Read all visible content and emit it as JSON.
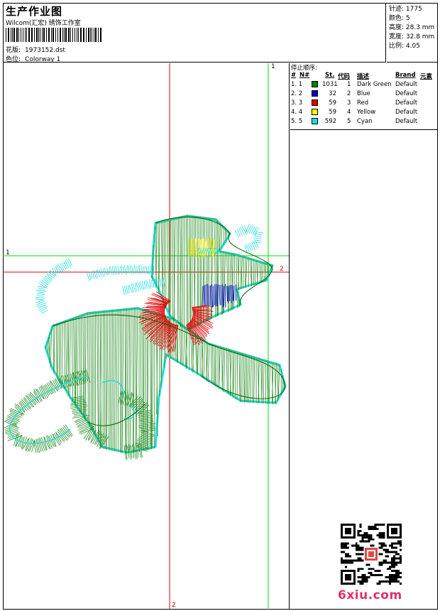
{
  "header": {
    "title": "生产作业图",
    "subtitle": "Wilcom(汇宏) 绣饰工作室",
    "file_label": "花版:",
    "file_name": "1973152.dst",
    "colorway_label": "色位:",
    "colorway_name": "Colorway 1"
  },
  "stats": {
    "stitches": "针迹: 1775",
    "colors": "颜色: 5",
    "height": "高度: 28.3 mm",
    "width": "宽度: 32.8 mm",
    "scale": "比例: 4.05"
  },
  "axis_labels": {
    "top_right": "1",
    "left": "1",
    "right": "2",
    "bottom": "2"
  },
  "color_table": {
    "caption": "停止顺序:",
    "headers": [
      "#",
      "N#",
      "St.",
      "代码",
      "描述",
      "Brand",
      "元素"
    ],
    "rows": [
      {
        "idx": "1. 1",
        "color": "#008000",
        "st": "1031",
        "code": "1",
        "desc": "Dark Green",
        "brand": "Default"
      },
      {
        "idx": "2. 2",
        "color": "#0000cc",
        "st": "32",
        "code": "2",
        "desc": "Blue",
        "brand": "Default"
      },
      {
        "idx": "3. 3",
        "color": "#e00000",
        "st": "59",
        "code": "3",
        "desc": "Red",
        "brand": "Default"
      },
      {
        "idx": "4. 4",
        "color": "#ffff00",
        "st": "59",
        "code": "4",
        "desc": "Yellow",
        "brand": "Default"
      },
      {
        "idx": "5. 5",
        "color": "#00e5e5",
        "st": "592",
        "code": "5",
        "desc": "Cyan",
        "brand": "Default"
      }
    ]
  },
  "logo": "6xiu.com"
}
